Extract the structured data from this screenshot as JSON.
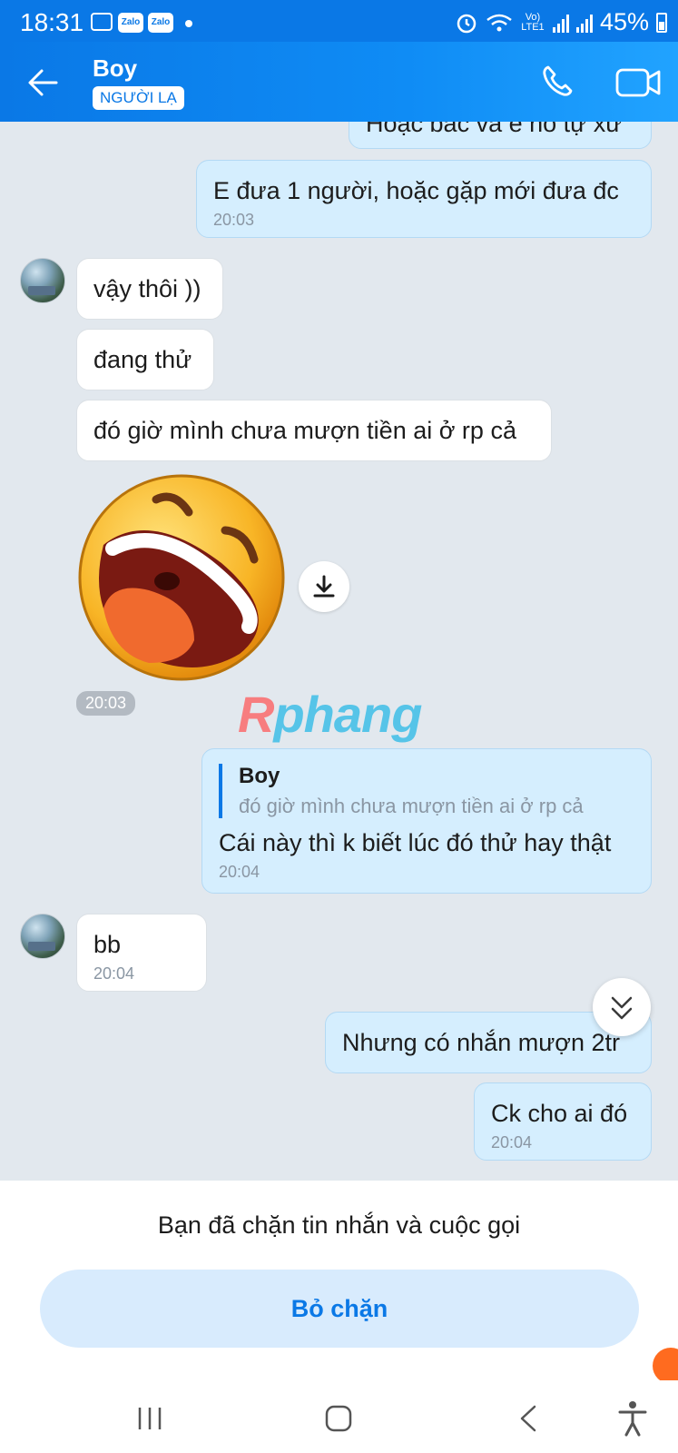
{
  "status_bar": {
    "time": "18:31",
    "notif_icons": [
      "gallery-icon",
      "zalo-icon",
      "zalo-icon"
    ],
    "zalo_label": "Zalo",
    "network": "Vo) LTE1",
    "battery": "45%"
  },
  "header": {
    "title": "Boy",
    "badge": "NGƯỜI LẠ"
  },
  "messages": [
    {
      "side": "out",
      "text": "Hoặc bác và e hỏ tự xử",
      "time": ""
    },
    {
      "side": "out",
      "text": "E đưa 1 người, hoặc gặp mới đưa đc",
      "time": "20:03"
    },
    {
      "side": "in",
      "text": "vậy thôi ))",
      "time": ""
    },
    {
      "side": "in",
      "text": "đang thử",
      "time": ""
    },
    {
      "side": "in",
      "text": "đó giờ mình chưa mượn tiền ai ở rp cả",
      "time": ""
    },
    {
      "side": "in",
      "type": "sticker",
      "sticker": "laughing-emoji",
      "time": "20:03"
    },
    {
      "side": "out",
      "reply_to": {
        "name": "Boy",
        "text": "đó giờ mình chưa mượn tiền ai ở rp cả"
      },
      "text": "Cái này thì k biết lúc đó thử hay thật",
      "time": "20:04"
    },
    {
      "side": "in",
      "text": "bb",
      "time": "20:04"
    },
    {
      "side": "out",
      "text": "Nhưng có nhắn mượn 2tr",
      "time": ""
    },
    {
      "side": "out",
      "text": "Ck cho ai đó",
      "time": "20:04"
    }
  ],
  "watermark": {
    "part1": "R",
    "part2": "phang"
  },
  "blocked_panel": {
    "text": "Bạn đã chặn tin nhắn và cuộc gọi",
    "button": "Bỏ chặn"
  },
  "colors": {
    "header": "#0a78e6",
    "outgoing_bubble": "#d5eefe",
    "incoming_bubble": "#ffffff",
    "chat_background": "#e2e8ee",
    "unblock_button": "#d8ebfd"
  },
  "icons": {
    "back": "arrow-left-icon",
    "call": "phone-icon",
    "video": "video-camera-icon",
    "download": "download-icon",
    "scroll": "double-chevron-down-icon",
    "nav": [
      "recents-icon",
      "home-icon",
      "back-icon",
      "accessibility-icon"
    ]
  }
}
